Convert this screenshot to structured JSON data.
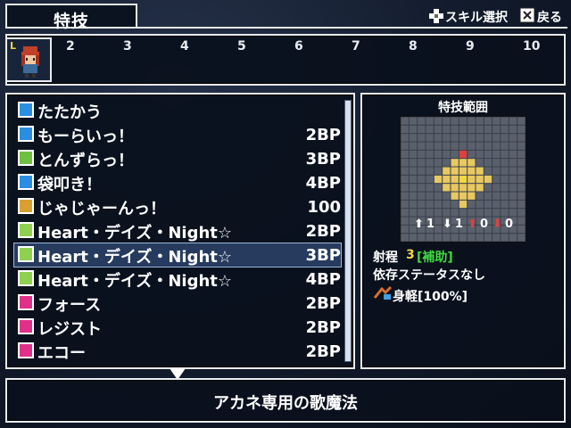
{
  "header": {
    "title": "特技",
    "hint_select": "スキル選択",
    "hint_back": "戻る"
  },
  "party": {
    "active_badge": "L",
    "slots": [
      "2",
      "3",
      "4",
      "5",
      "6",
      "7",
      "8",
      "9",
      "10"
    ]
  },
  "skills": [
    {
      "name": "たたかう",
      "cost": "",
      "icon": "attack-icon",
      "color": "#2a8fe0"
    },
    {
      "name": "もーらいっ！",
      "cost": "2BP",
      "icon": "skill-icon",
      "color": "#2a8fe0"
    },
    {
      "name": "とんずらっ！",
      "cost": "3BP",
      "icon": "escape-icon",
      "color": "#6fc040"
    },
    {
      "name": "袋叩き！",
      "cost": "4BP",
      "icon": "skill-icon",
      "color": "#2a8fe0"
    },
    {
      "name": "じゃじゃーんっ！",
      "cost": "100",
      "icon": "special-icon",
      "color": "#d8a030"
    },
    {
      "name": "Heart・デイズ・Night☆",
      "cost": "2BP",
      "icon": "song-icon",
      "color": "#8fd050"
    },
    {
      "name": "Heart・デイズ・Night☆",
      "cost": "3BP",
      "icon": "song-icon",
      "color": "#8fd050"
    },
    {
      "name": "Heart・デイズ・Night☆",
      "cost": "4BP",
      "icon": "song-icon",
      "color": "#8fd050"
    },
    {
      "name": "フォース",
      "cost": "2BP",
      "icon": "vo-icon",
      "color": "#e0308a"
    },
    {
      "name": "レジスト",
      "cost": "2BP",
      "icon": "vo-icon",
      "color": "#e0308a"
    },
    {
      "name": "エコー",
      "cost": "2BP",
      "icon": "vo-icon",
      "color": "#e0308a"
    }
  ],
  "selected_index": 6,
  "info": {
    "range_title": "特技範囲",
    "counts": [
      "1",
      "1",
      "0",
      "0"
    ],
    "range_label": "射程",
    "range_value": "3",
    "range_type": "[補助]",
    "dependency": "依存ステータスなし",
    "effect": "身軽[100%]"
  },
  "description": "アカネ専用の歌魔法",
  "colors": {
    "accent_yellow": "#f0d840",
    "accent_green": "#40d840",
    "selected_row": "#263b5e"
  }
}
